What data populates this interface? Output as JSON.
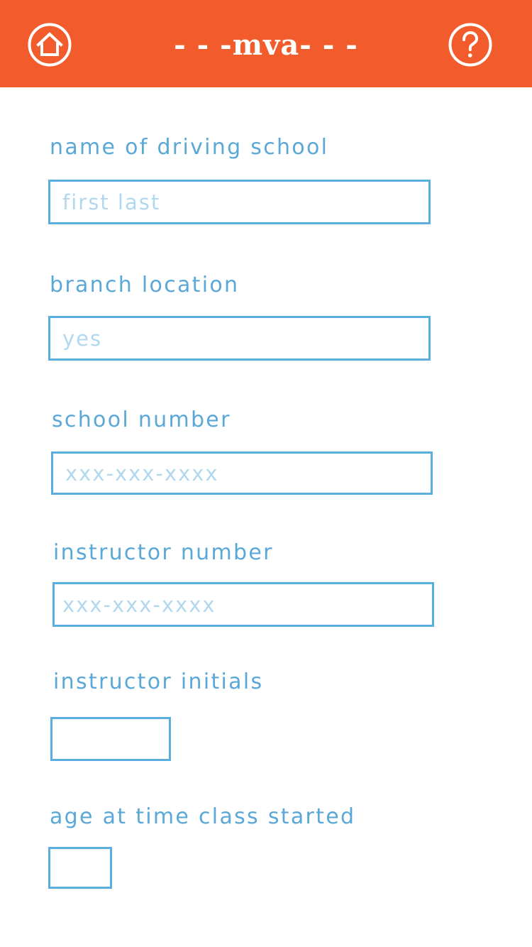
{
  "header": {
    "title": "- - -mva- - -",
    "background_color": "#f25c2c",
    "home_icon": "home-icon",
    "help_icon": "question-mark-icon"
  },
  "form": {
    "accent_color": "#5aaee0",
    "fields": [
      {
        "label": "name of driving school",
        "placeholder": "first last",
        "value": ""
      },
      {
        "label": "branch location",
        "placeholder": "yes",
        "value": ""
      },
      {
        "label": "school number",
        "placeholder": "xxx-xxx-xxxx",
        "value": ""
      },
      {
        "label": "instructor number",
        "placeholder": "xxx-xxx-xxxx",
        "value": ""
      },
      {
        "label": "instructor initials",
        "placeholder": "",
        "value": ""
      },
      {
        "label": "age at time class started",
        "placeholder": "",
        "value": ""
      }
    ]
  }
}
